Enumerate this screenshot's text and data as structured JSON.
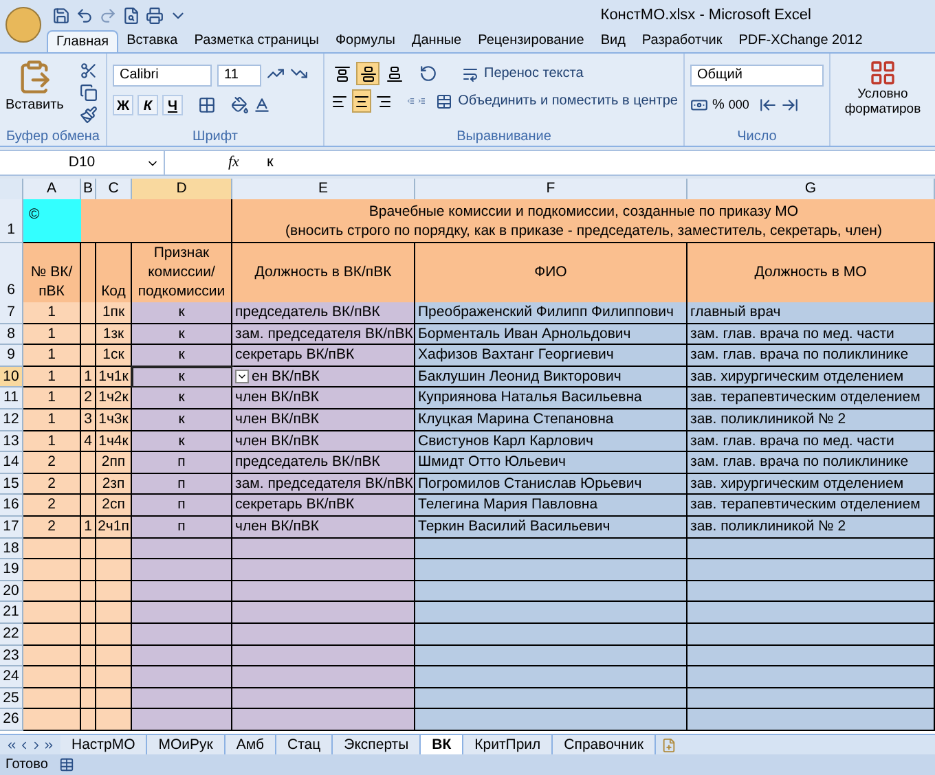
{
  "window": {
    "title": "КонстМО.xlsx - Microsoft Excel"
  },
  "ribbon": {
    "tabs": [
      {
        "label": "Главная",
        "selected": true
      },
      {
        "label": "Вставка",
        "selected": false
      },
      {
        "label": "Разметка страницы",
        "selected": false
      },
      {
        "label": "Формулы",
        "selected": false
      },
      {
        "label": "Данные",
        "selected": false
      },
      {
        "label": "Рецензирование",
        "selected": false
      },
      {
        "label": "Вид",
        "selected": false
      },
      {
        "label": "Разработчик",
        "selected": false
      },
      {
        "label": "PDF-XChange 2012",
        "selected": false
      }
    ],
    "clipboard": {
      "label": "Буфер обмена",
      "paste": "Вставить"
    },
    "font": {
      "label": "Шрифт",
      "name": "Calibri",
      "size": "11",
      "bold": "Ж",
      "italic": "К",
      "underline": "Ч"
    },
    "alignment": {
      "label": "Выравнивание",
      "vertical": [
        {
          "selected": false
        },
        {
          "selected": true
        },
        {
          "selected": false
        }
      ],
      "horizontal": [
        {
          "selected": false
        },
        {
          "selected": true
        },
        {
          "selected": false
        }
      ],
      "wrap": "Перенос текста",
      "merge": "Объединить и поместить в центре"
    },
    "number": {
      "label": "Число",
      "format": "Общий",
      "percent": "%",
      "thousands": "000"
    },
    "styles": {
      "conditional": "Условно",
      "conditional_2": "форматиров"
    }
  },
  "formula_bar": {
    "name_box": "D10",
    "fx": "fx",
    "value": "к"
  },
  "columns": [
    {
      "label": "A",
      "selected": false
    },
    {
      "label": "B",
      "selected": false
    },
    {
      "label": "C",
      "selected": false
    },
    {
      "label": "D",
      "selected": true
    },
    {
      "label": "E",
      "selected": false
    },
    {
      "label": "F",
      "selected": false
    },
    {
      "label": "G",
      "selected": false
    }
  ],
  "title_row": {
    "number": "1",
    "a": "©",
    "line_1": "Врачебные комиссии и подкомиссии, созданные по приказу МО",
    "line_2": "(вносить строго по порядку, как в приказе - председатель, заместитель, секретарь, член)"
  },
  "header_row": {
    "number": "6",
    "a": "№ ВК/пВК",
    "c": "Код",
    "d": "Признак комиссии/ подкомиссии",
    "e": "Должность в ВК/пВК",
    "f": "ФИО",
    "g": "Должность в МО"
  },
  "rows": [
    {
      "number": "7",
      "selected": false,
      "a": "1",
      "c": "1пк",
      "d": "к",
      "e": "председатель ВК/пВК",
      "f": "Преображенский Филипп Филиппович",
      "g": "главный врач"
    },
    {
      "number": "8",
      "selected": false,
      "a": "1",
      "c": "1зк",
      "d": "к",
      "e": "зам. председателя ВК/пВК",
      "f": "Борменталь Иван Арнольдович",
      "g": "зам. глав. врача по мед. части"
    },
    {
      "number": "9",
      "selected": false,
      "a": "1",
      "c": "1ск",
      "d": "к",
      "e": "секретарь  ВК/пВК",
      "f": "Хафизов Вахтанг Георгиевич",
      "g": "зам. глав. врача по поликлинике"
    },
    {
      "number": "10",
      "selected": true,
      "a": "1",
      "b": "1",
      "c": "1ч1к",
      "d": "к",
      "e": "ен ВК/пВК",
      "dropdown": true,
      "f": "Баклушин Леонид Викторович",
      "g": "зав. хирургическим отделением"
    },
    {
      "number": "11",
      "selected": false,
      "a": "1",
      "b": "2",
      "c": "1ч2к",
      "d": "к",
      "e": "член ВК/пВК",
      "f": "Куприянова Наталья Васильевна",
      "g": "зав. терапевтическим отделением"
    },
    {
      "number": "12",
      "selected": false,
      "a": "1",
      "b": "3",
      "c": "1ч3к",
      "d": "к",
      "e": "член ВК/пВК",
      "f": "Клуцкая Марина Степановна",
      "g": "зав. поликлиникой № 2"
    },
    {
      "number": "13",
      "selected": false,
      "a": "1",
      "b": "4",
      "c": "1ч4к",
      "d": "к",
      "e": "член ВК/пВК",
      "f": "Свистунов Карл Карлович",
      "g": "зам. глав. врача по мед. части"
    },
    {
      "number": "14",
      "selected": false,
      "a": "2",
      "c": "2пп",
      "d": "п",
      "e": "председатель ВК/пВК",
      "f": "Шмидт Отто Юльевич",
      "g": "зам. глав. врача по поликлинике"
    },
    {
      "number": "15",
      "selected": false,
      "a": "2",
      "c": "2зп",
      "d": "п",
      "e": "зам. председателя ВК/пВК",
      "f": "Погромилов Станислав Юрьевич",
      "g": "зав. хирургическим отделением"
    },
    {
      "number": "16",
      "selected": false,
      "a": "2",
      "c": "2сп",
      "d": "п",
      "e": "секретарь  ВК/пВК",
      "f": "Телегина Мария Павловна",
      "g": "зав. терапевтическим отделением"
    },
    {
      "number": "17",
      "selected": false,
      "a": "2",
      "b": "1",
      "c": "2ч1п",
      "d": "п",
      "e": "член ВК/пВК",
      "f": "Теркин Василий Васильевич",
      "g": "зав. поликлиникой № 2"
    },
    {
      "number": "18",
      "selected": false
    },
    {
      "number": "19",
      "selected": false
    },
    {
      "number": "20",
      "selected": false
    },
    {
      "number": "21",
      "selected": false
    },
    {
      "number": "22",
      "selected": false
    },
    {
      "number": "23",
      "selected": false
    },
    {
      "number": "24",
      "selected": false
    },
    {
      "number": "25",
      "selected": false
    },
    {
      "number": "26",
      "selected": false
    }
  ],
  "sheet_tabs": [
    {
      "label": "НастрМО",
      "selected": false
    },
    {
      "label": "МОиРук",
      "selected": false
    },
    {
      "label": "Амб",
      "selected": false
    },
    {
      "label": "Стац",
      "selected": false
    },
    {
      "label": "Эксперты",
      "selected": false
    },
    {
      "label": "ВК",
      "selected": true
    },
    {
      "label": "КритПрил",
      "selected": false
    },
    {
      "label": "Справочник",
      "selected": false
    }
  ],
  "status_bar": {
    "text": "Готово"
  }
}
